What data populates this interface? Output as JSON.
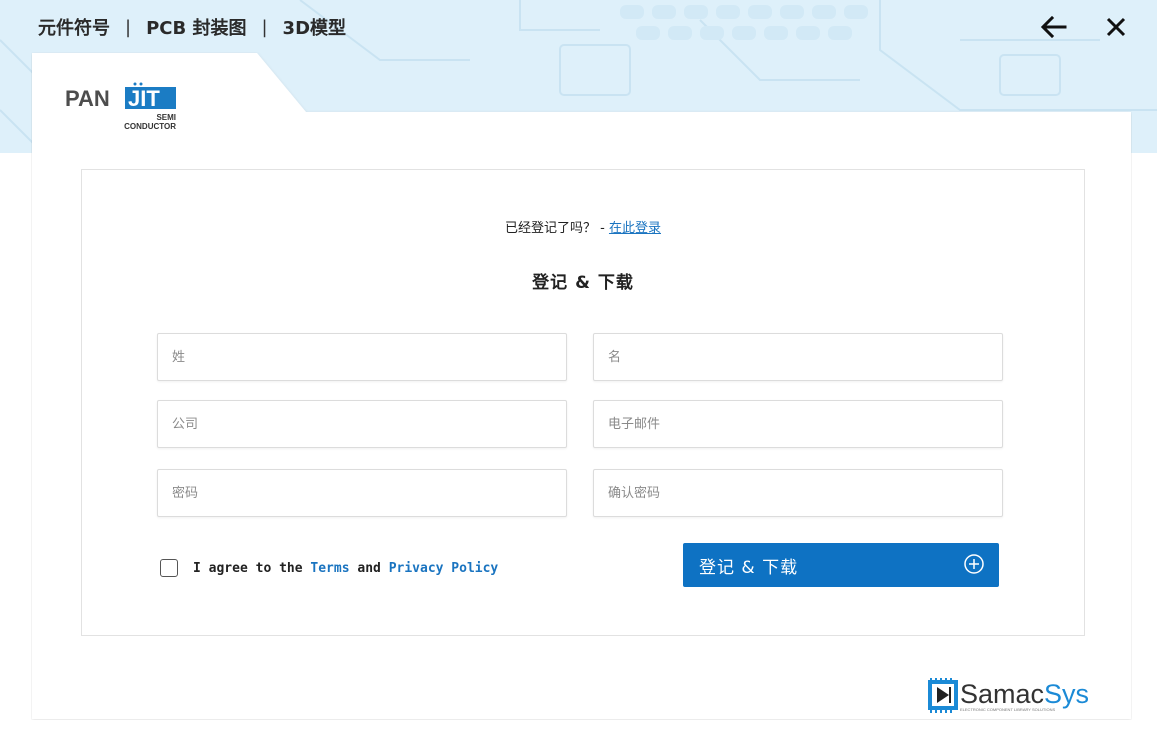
{
  "header": {
    "tab_symbol": "元件符号",
    "separator": "|",
    "tab_pcb": "PCB 封装图",
    "tab_3d": "3D模型"
  },
  "logo": {
    "brand_left": "PAN",
    "brand_right": "JIT",
    "sub_line1": "SEMI",
    "sub_line2": "CONDUCTOR"
  },
  "form": {
    "already_registered": "已经登记了吗？ -",
    "login_link": "在此登录",
    "title": "登记 & 下载",
    "fields": {
      "last_name": "姓",
      "first_name": "名",
      "company": "公司",
      "email": "电子邮件",
      "password": "密码",
      "confirm_password": "确认密码"
    },
    "agree": {
      "prefix": "I agree to the",
      "terms": "Terms",
      "and": "and",
      "privacy": "Privacy Policy"
    },
    "submit_label": "登记 & 下载"
  },
  "footer": {
    "samacsys_name": "SamacSys",
    "samacsys_tagline": "ELECTRONIC COMPONENT LIBRARY SOLUTIONS"
  },
  "colors": {
    "accent": "#0e72c3",
    "link": "#1a74c0",
    "header_band": "#def0fa"
  }
}
